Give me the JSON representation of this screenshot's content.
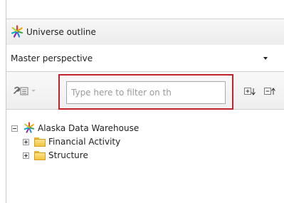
{
  "panel": {
    "title": "Universe outline",
    "icon": "universe-star-icon"
  },
  "perspective": {
    "selected": "Master perspective"
  },
  "toolbar": {
    "filter_placeholder": "Type here to filter on th",
    "filter_value": "",
    "tool_icon": "wrench-icon",
    "expand_icon": "expand-all-icon",
    "collapse_icon": "collapse-all-icon"
  },
  "tree": {
    "root": {
      "label": "Alaska Data Warehouse",
      "expanded": true
    },
    "children": [
      {
        "label": "Financial Activity",
        "expanded": false
      },
      {
        "label": "Structure",
        "expanded": false
      }
    ]
  },
  "colors": {
    "highlight": "#c0232b",
    "folder": "#f2c440",
    "star_colors": [
      "#e53935",
      "#f4a300",
      "#43a047",
      "#1e88e5",
      "#8e24aa"
    ]
  }
}
